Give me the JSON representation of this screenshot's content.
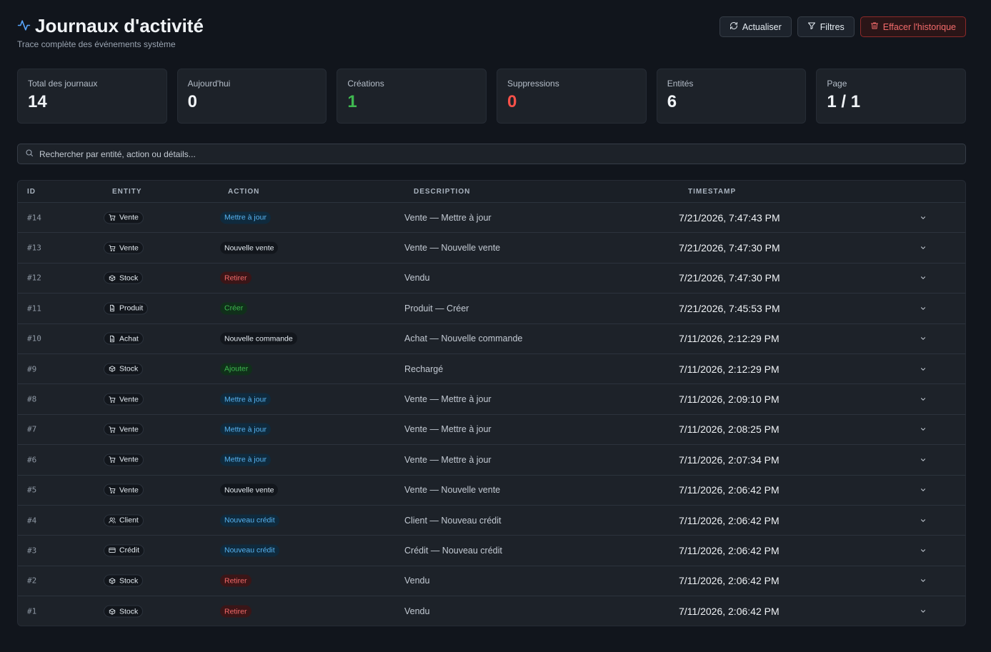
{
  "header": {
    "title": "Journaux d'activité",
    "subtitle": "Trace complète des événements système",
    "refresh_label": "Actualiser",
    "filters_label": "Filtres",
    "clear_label": "Effacer l'historique"
  },
  "stats": [
    {
      "label": "Total des journaux",
      "value": "14"
    },
    {
      "label": "Aujourd'hui",
      "value": "0"
    },
    {
      "label": "Créations",
      "value": "1"
    },
    {
      "label": "Suppressions",
      "value": "0"
    },
    {
      "label": "Entités",
      "value": "6"
    },
    {
      "label": "Page",
      "value": "1 / 1"
    }
  ],
  "search": {
    "placeholder": "Rechercher par entité, action ou détails..."
  },
  "table": {
    "columns": [
      "ID",
      "ENTITY",
      "ACTION",
      "DESCRIPTION",
      "TIMESTAMP"
    ],
    "rows": [
      {
        "id": "#14",
        "entity": "Vente",
        "entity_icon": "cart-icon",
        "action": "Mettre à jour",
        "action_type": "update",
        "description": "Vente — Mettre à jour",
        "timestamp": "7/21/2026, 7:47:43 PM"
      },
      {
        "id": "#13",
        "entity": "Vente",
        "entity_icon": "cart-icon",
        "action": "Nouvelle vente",
        "action_type": "neutral",
        "description": "Vente — Nouvelle vente",
        "timestamp": "7/21/2026, 7:47:30 PM"
      },
      {
        "id": "#12",
        "entity": "Stock",
        "entity_icon": "box-icon",
        "action": "Retirer",
        "action_type": "remove",
        "description": "Vendu",
        "timestamp": "7/21/2026, 7:47:30 PM"
      },
      {
        "id": "#11",
        "entity": "Produit",
        "entity_icon": "document-icon",
        "action": "Créer",
        "action_type": "create",
        "description": "Produit — Créer",
        "timestamp": "7/21/2026, 7:45:53 PM"
      },
      {
        "id": "#10",
        "entity": "Achat",
        "entity_icon": "document-icon",
        "action": "Nouvelle commande",
        "action_type": "neutral",
        "description": "Achat — Nouvelle commande",
        "timestamp": "7/11/2026, 2:12:29 PM"
      },
      {
        "id": "#9",
        "entity": "Stock",
        "entity_icon": "box-icon",
        "action": "Ajouter",
        "action_type": "create",
        "description": "Rechargé",
        "timestamp": "7/11/2026, 2:12:29 PM"
      },
      {
        "id": "#8",
        "entity": "Vente",
        "entity_icon": "cart-icon",
        "action": "Mettre à jour",
        "action_type": "update",
        "description": "Vente — Mettre à jour",
        "timestamp": "7/11/2026, 2:09:10 PM"
      },
      {
        "id": "#7",
        "entity": "Vente",
        "entity_icon": "cart-icon",
        "action": "Mettre à jour",
        "action_type": "update",
        "description": "Vente — Mettre à jour",
        "timestamp": "7/11/2026, 2:08:25 PM"
      },
      {
        "id": "#6",
        "entity": "Vente",
        "entity_icon": "cart-icon",
        "action": "Mettre à jour",
        "action_type": "update",
        "description": "Vente — Mettre à jour",
        "timestamp": "7/11/2026, 2:07:34 PM"
      },
      {
        "id": "#5",
        "entity": "Vente",
        "entity_icon": "cart-icon",
        "action": "Nouvelle vente",
        "action_type": "neutral",
        "description": "Vente — Nouvelle vente",
        "timestamp": "7/11/2026, 2:06:42 PM"
      },
      {
        "id": "#4",
        "entity": "Client",
        "entity_icon": "users-icon",
        "action": "Nouveau crédit",
        "action_type": "update",
        "description": "Client — Nouveau crédit",
        "timestamp": "7/11/2026, 2:06:42 PM"
      },
      {
        "id": "#3",
        "entity": "Crédit",
        "entity_icon": "credit-card-icon",
        "action": "Nouveau crédit",
        "action_type": "update",
        "description": "Crédit — Nouveau crédit",
        "timestamp": "7/11/2026, 2:06:42 PM"
      },
      {
        "id": "#2",
        "entity": "Stock",
        "entity_icon": "box-icon",
        "action": "Retirer",
        "action_type": "remove",
        "description": "Vendu",
        "timestamp": "7/11/2026, 2:06:42 PM"
      },
      {
        "id": "#1",
        "entity": "Stock",
        "entity_icon": "box-icon",
        "action": "Retirer",
        "action_type": "remove",
        "description": "Vendu",
        "timestamp": "7/11/2026, 2:06:42 PM"
      }
    ]
  },
  "colors": {
    "background": "#11151c",
    "card": "#1d2229",
    "accent_blue": "#58b4f2",
    "success_green": "#3fb950",
    "danger_red": "#f85149"
  }
}
